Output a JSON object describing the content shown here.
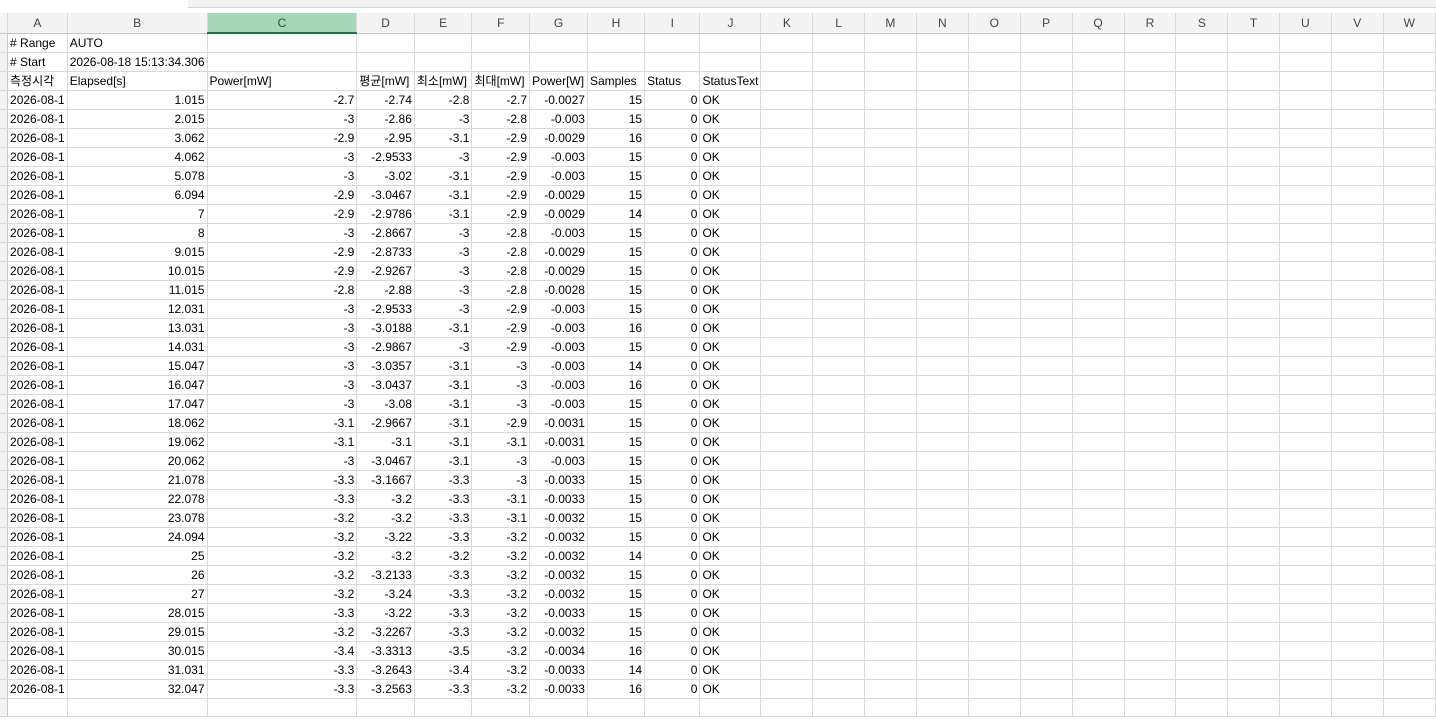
{
  "columns": [
    "A",
    "B",
    "C",
    "D",
    "E",
    "F",
    "G",
    "H",
    "I",
    "J",
    "K",
    "L",
    "M",
    "N",
    "O",
    "P",
    "Q",
    "R",
    "S",
    "T",
    "U",
    "V",
    "W"
  ],
  "selected_column": "C",
  "meta_rows": [
    [
      "# Range",
      "AUTO"
    ],
    [
      "# Start",
      "2026-08-18 15:13:34.306"
    ]
  ],
  "headers": [
    "측정시각",
    "Elapsed[s]",
    "Power[mW]",
    "평균[mW]",
    "최소[mW]",
    "최대[mW]",
    "Power[W]",
    "Samples",
    "Status",
    "StatusText"
  ],
  "rows": [
    [
      "2026-08-1",
      "1.015",
      "-2.7",
      "-2.74",
      "-2.8",
      "-2.7",
      "-0.0027",
      "15",
      "0",
      "OK"
    ],
    [
      "2026-08-1",
      "2.015",
      "-3",
      "-2.86",
      "-3",
      "-2.8",
      "-0.003",
      "15",
      "0",
      "OK"
    ],
    [
      "2026-08-1",
      "3.062",
      "-2.9",
      "-2.95",
      "-3.1",
      "-2.9",
      "-0.0029",
      "16",
      "0",
      "OK"
    ],
    [
      "2026-08-1",
      "4.062",
      "-3",
      "-2.9533",
      "-3",
      "-2.9",
      "-0.003",
      "15",
      "0",
      "OK"
    ],
    [
      "2026-08-1",
      "5.078",
      "-3",
      "-3.02",
      "-3.1",
      "-2.9",
      "-0.003",
      "15",
      "0",
      "OK"
    ],
    [
      "2026-08-1",
      "6.094",
      "-2.9",
      "-3.0467",
      "-3.1",
      "-2.9",
      "-0.0029",
      "15",
      "0",
      "OK"
    ],
    [
      "2026-08-1",
      "7",
      "-2.9",
      "-2.9786",
      "-3.1",
      "-2.9",
      "-0.0029",
      "14",
      "0",
      "OK"
    ],
    [
      "2026-08-1",
      "8",
      "-3",
      "-2.8667",
      "-3",
      "-2.8",
      "-0.003",
      "15",
      "0",
      "OK"
    ],
    [
      "2026-08-1",
      "9.015",
      "-2.9",
      "-2.8733",
      "-3",
      "-2.8",
      "-0.0029",
      "15",
      "0",
      "OK"
    ],
    [
      "2026-08-1",
      "10.015",
      "-2.9",
      "-2.9267",
      "-3",
      "-2.8",
      "-0.0029",
      "15",
      "0",
      "OK"
    ],
    [
      "2026-08-1",
      "11.015",
      "-2.8",
      "-2.88",
      "-3",
      "-2.8",
      "-0.0028",
      "15",
      "0",
      "OK"
    ],
    [
      "2026-08-1",
      "12.031",
      "-3",
      "-2.9533",
      "-3",
      "-2.9",
      "-0.003",
      "15",
      "0",
      "OK"
    ],
    [
      "2026-08-1",
      "13.031",
      "-3",
      "-3.0188",
      "-3.1",
      "-2.9",
      "-0.003",
      "16",
      "0",
      "OK"
    ],
    [
      "2026-08-1",
      "14.031",
      "-3",
      "-2.9867",
      "-3",
      "-2.9",
      "-0.003",
      "15",
      "0",
      "OK"
    ],
    [
      "2026-08-1",
      "15.047",
      "-3",
      "-3.0357",
      "-3.1",
      "-3",
      "-0.003",
      "14",
      "0",
      "OK"
    ],
    [
      "2026-08-1",
      "16.047",
      "-3",
      "-3.0437",
      "-3.1",
      "-3",
      "-0.003",
      "16",
      "0",
      "OK"
    ],
    [
      "2026-08-1",
      "17.047",
      "-3",
      "-3.08",
      "-3.1",
      "-3",
      "-0.003",
      "15",
      "0",
      "OK"
    ],
    [
      "2026-08-1",
      "18.062",
      "-3.1",
      "-2.9667",
      "-3.1",
      "-2.9",
      "-0.0031",
      "15",
      "0",
      "OK"
    ],
    [
      "2026-08-1",
      "19.062",
      "-3.1",
      "-3.1",
      "-3.1",
      "-3.1",
      "-0.0031",
      "15",
      "0",
      "OK"
    ],
    [
      "2026-08-1",
      "20.062",
      "-3",
      "-3.0467",
      "-3.1",
      "-3",
      "-0.003",
      "15",
      "0",
      "OK"
    ],
    [
      "2026-08-1",
      "21.078",
      "-3.3",
      "-3.1667",
      "-3.3",
      "-3",
      "-0.0033",
      "15",
      "0",
      "OK"
    ],
    [
      "2026-08-1",
      "22.078",
      "-3.3",
      "-3.2",
      "-3.3",
      "-3.1",
      "-0.0033",
      "15",
      "0",
      "OK"
    ],
    [
      "2026-08-1",
      "23.078",
      "-3.2",
      "-3.2",
      "-3.3",
      "-3.1",
      "-0.0032",
      "15",
      "0",
      "OK"
    ],
    [
      "2026-08-1",
      "24.094",
      "-3.2",
      "-3.22",
      "-3.3",
      "-3.2",
      "-0.0032",
      "15",
      "0",
      "OK"
    ],
    [
      "2026-08-1",
      "25",
      "-3.2",
      "-3.2",
      "-3.2",
      "-3.2",
      "-0.0032",
      "14",
      "0",
      "OK"
    ],
    [
      "2026-08-1",
      "26",
      "-3.2",
      "-3.2133",
      "-3.3",
      "-3.2",
      "-0.0032",
      "15",
      "0",
      "OK"
    ],
    [
      "2026-08-1",
      "27",
      "-3.2",
      "-3.24",
      "-3.3",
      "-3.2",
      "-0.0032",
      "15",
      "0",
      "OK"
    ],
    [
      "2026-08-1",
      "28.015",
      "-3.3",
      "-3.22",
      "-3.3",
      "-3.2",
      "-0.0033",
      "15",
      "0",
      "OK"
    ],
    [
      "2026-08-1",
      "29.015",
      "-3.2",
      "-3.2267",
      "-3.3",
      "-3.2",
      "-0.0032",
      "15",
      "0",
      "OK"
    ],
    [
      "2026-08-1",
      "30.015",
      "-3.4",
      "-3.3313",
      "-3.5",
      "-3.2",
      "-0.0034",
      "16",
      "0",
      "OK"
    ],
    [
      "2026-08-1",
      "31.031",
      "-3.3",
      "-3.2643",
      "-3.4",
      "-3.2",
      "-0.0033",
      "14",
      "0",
      "OK"
    ],
    [
      "2026-08-1",
      "32.047",
      "-3.3",
      "-3.2563",
      "-3.3",
      "-3.2",
      "-0.0033",
      "16",
      "0",
      "OK"
    ]
  ],
  "text_columns": [
    0,
    9
  ]
}
